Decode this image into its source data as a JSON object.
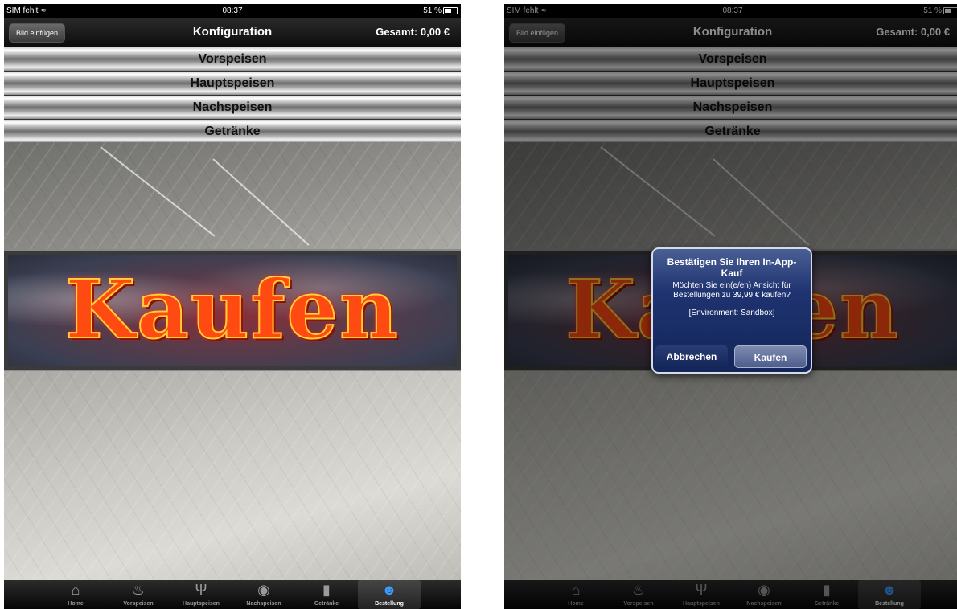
{
  "status_bar": {
    "carrier": "SIM fehlt",
    "time": "08:37",
    "battery": "51 %"
  },
  "nav": {
    "left_button": "Bild einfügen",
    "title": "Konfiguration",
    "total": "Gesamt: 0,00 €"
  },
  "menu": {
    "items": [
      "Vorspeisen",
      "Hauptspeisen",
      "Nachspeisen",
      "Getränke"
    ]
  },
  "banner": {
    "text": "Kaufen"
  },
  "tabs": [
    {
      "label": "Home",
      "icon": "house-icon"
    },
    {
      "label": "Vorspeisen",
      "icon": "appetizer-icon"
    },
    {
      "label": "Hauptspeisen",
      "icon": "fork-knife-icon"
    },
    {
      "label": "Nachspeisen",
      "icon": "dessert-icon"
    },
    {
      "label": "Getränke",
      "icon": "bottle-icon"
    },
    {
      "label": "Bestellung",
      "icon": "waiter-icon"
    }
  ],
  "selected_tab": "Bestellung",
  "alert": {
    "title": "Bestätigen Sie Ihren In-App-Kauf",
    "message": "Möchten Sie ein(e/en) Ansicht für Bestellungen zu 39,99 € kaufen?",
    "environment": "[Environment: Sandbox]",
    "cancel": "Abbrechen",
    "confirm": "Kaufen"
  },
  "colors": {
    "banner_text": "#ff4a12",
    "alert_bg": "#1e3370",
    "selected_tab_icon": "#3b9cff"
  }
}
